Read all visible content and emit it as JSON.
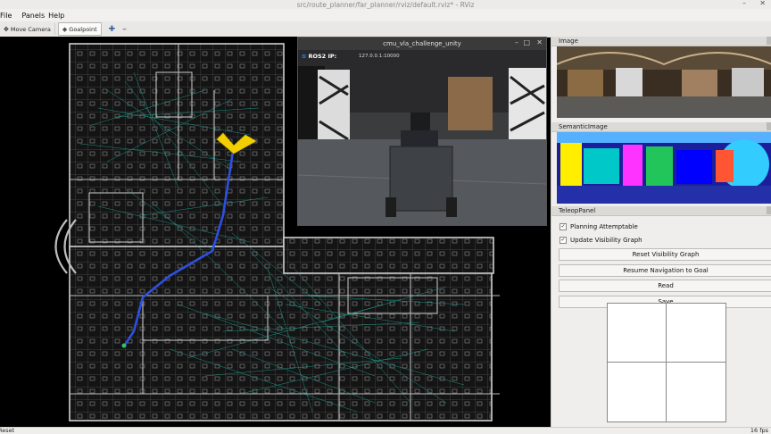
{
  "window": {
    "title": "src/route_planner/far_planner/rviz/default.rviz* - RViz"
  },
  "menu": {
    "file": "File",
    "panels": "Panels",
    "help": "Help"
  },
  "toolbar": {
    "move_camera": "Move Camera",
    "goalpoint": "Goalpoint"
  },
  "sim_window": {
    "title": "cmu_vla_challenge_unity",
    "ros_label": "ROS2 IP:",
    "ros_ip": "127.0.0.1:10000"
  },
  "panels": {
    "image": {
      "title": "Image"
    },
    "semantic": {
      "title": "SemanticImage"
    },
    "teleop": {
      "title": "TeleopPanel",
      "checkboxes": [
        {
          "label": "Planning Attemptable",
          "checked": true
        },
        {
          "label": "Update Visibility Graph",
          "checked": true
        }
      ],
      "buttons": [
        "Reset Visibility Graph",
        "Resume Navigation to Goal",
        "Read",
        "Save"
      ]
    }
  },
  "status": {
    "reset": "Reset",
    "fps": "16 fps"
  },
  "colors": {
    "trajectory": "#2f4fe0",
    "visibility_graph": "#1fb7a5",
    "goal_marker": "#f2cf00"
  }
}
